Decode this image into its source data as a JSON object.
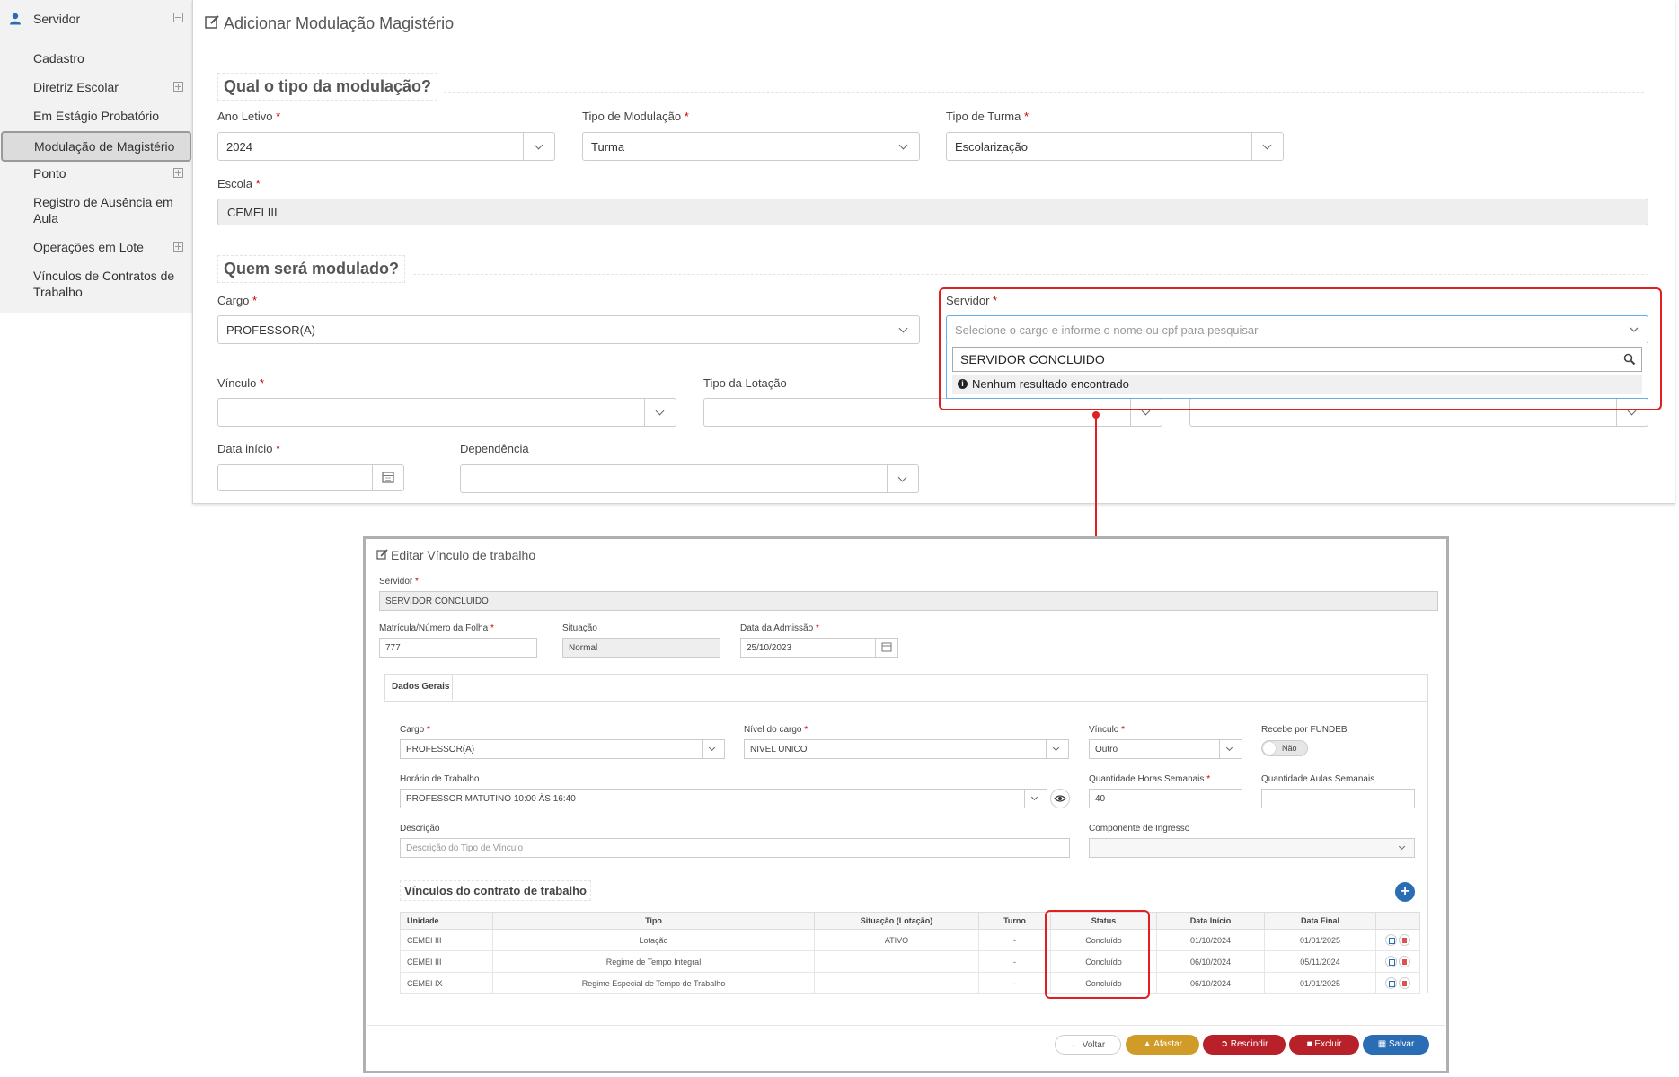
{
  "sidebar": {
    "header": "Servidor",
    "items": [
      {
        "label": "Cadastro"
      },
      {
        "label": "Diretriz Escolar"
      },
      {
        "label": "Em Estágio Probatório"
      },
      {
        "label": "Modulação de Magistério"
      },
      {
        "label": "Ponto"
      },
      {
        "label": "Registro de Ausência em Aula"
      },
      {
        "label": "Operações em Lote"
      },
      {
        "label": "Vínculos de Contratos de Trabalho"
      }
    ]
  },
  "form": {
    "title": "Adicionar Modulação Magistério",
    "section1": "Qual o tipo da modulação?",
    "ano_letivo": {
      "label": "Ano Letivo",
      "value": "2024"
    },
    "tipo_modulacao": {
      "label": "Tipo de Modulação",
      "value": "Turma"
    },
    "tipo_turma": {
      "label": "Tipo de Turma",
      "value": "Escolarização"
    },
    "escola": {
      "label": "Escola",
      "value": "CEMEI III"
    },
    "section2": "Quem será modulado?",
    "cargo": {
      "label": "Cargo",
      "value": "PROFESSOR(A)"
    },
    "servidor": {
      "label": "Servidor",
      "placeholder": "Selecione o cargo e informe o nome ou cpf para pesquisar",
      "search_value": "SERVIDOR CONCLUIDO",
      "no_result": "Nenhum resultado encontrado"
    },
    "vinculo": {
      "label": "Vínculo"
    },
    "tipo_lotacao": {
      "label": "Tipo da Lotação"
    },
    "data_inicio": {
      "label": "Data início"
    },
    "dependencia": {
      "label": "Dependência"
    },
    "required_mark": "*"
  },
  "modal": {
    "title": "Editar Vínculo de trabalho",
    "servidor": {
      "label": "Servidor",
      "value": "SERVIDOR CONCLUIDO"
    },
    "matricula": {
      "label": "Matrícula/Número da Folha",
      "value": "777"
    },
    "situacao": {
      "label": "Situação",
      "value": "Normal"
    },
    "data_admissao": {
      "label": "Data da Admissão",
      "value": "25/10/2023"
    },
    "tab": "Dados Gerais",
    "cargo": {
      "label": "Cargo",
      "value": "PROFESSOR(A)"
    },
    "nivel_cargo": {
      "label": "Nível do cargo",
      "value": "NIVEL UNICO"
    },
    "vinculo": {
      "label": "Vínculo",
      "value": "Outro"
    },
    "recebe_fundeb": {
      "label": "Recebe por FUNDEB",
      "value": "Não"
    },
    "horario": {
      "label": "Horário de Trabalho",
      "value": "PROFESSOR MATUTINO 10:00 ÀS 16:40"
    },
    "qtd_horas": {
      "label": "Quantidade Horas Semanais",
      "value": "40"
    },
    "qtd_aulas": {
      "label": "Quantidade Aulas Semanais",
      "value": ""
    },
    "descricao": {
      "label": "Descrição",
      "placeholder": "Descrição do Tipo de Vínculo"
    },
    "componente": {
      "label": "Componente de Ingresso"
    },
    "section": "Vínculos do contrato de trabalho",
    "table": {
      "headers": [
        "Unidade",
        "Tipo",
        "Situação (Lotação)",
        "Turno",
        "Status",
        "Data Início",
        "Data Final"
      ],
      "rows": [
        [
          "CEMEI III",
          "Lotação",
          "ATIVO",
          "-",
          "Concluído",
          "01/10/2024",
          "01/01/2025"
        ],
        [
          "CEMEI III",
          "Regime de Tempo Integral",
          "",
          "-",
          "Concluído",
          "06/10/2024",
          "05/11/2024"
        ],
        [
          "CEMEI IX",
          "Regime Especial de Tempo de Trabalho",
          "",
          "-",
          "Concluído",
          "06/10/2024",
          "01/01/2025"
        ]
      ]
    },
    "buttons": {
      "voltar": "Voltar",
      "afastar": "Afastar",
      "rescindir": "Rescindir",
      "excluir": "Excluir",
      "salvar": "Salvar"
    }
  },
  "colors": {
    "highlight": "#e02020",
    "primary": "#2a6db5",
    "warning": "#d19b2a",
    "danger": "#b8202a"
  }
}
